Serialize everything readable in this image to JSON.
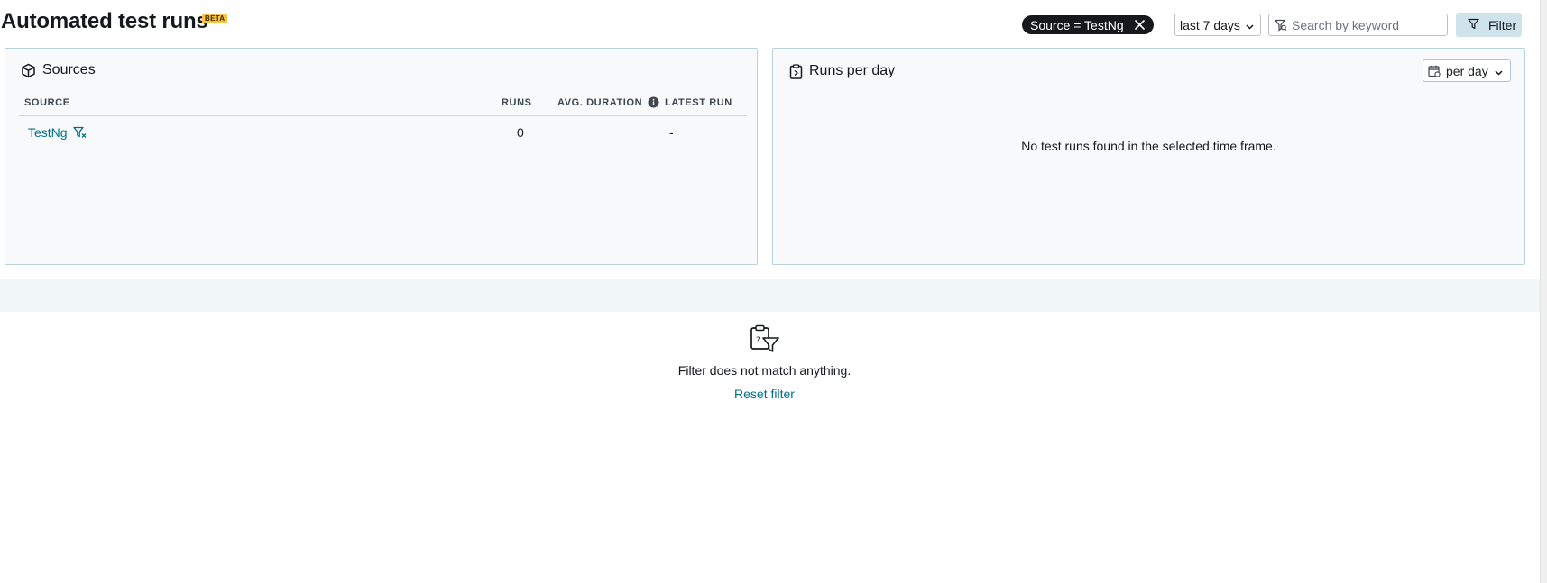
{
  "header": {
    "title": "Automated test runs",
    "badge": "BETA",
    "active_filter_chip": "Source = TestNg",
    "timeframe": "last 7 days",
    "search": {
      "placeholder": "Search by keyword",
      "value": ""
    },
    "filter_button": "Filter"
  },
  "sources_panel": {
    "title": "Sources",
    "columns": [
      "SOURCE",
      "RUNS",
      "AVG. DURATION",
      "LATEST RUN"
    ],
    "rows": [
      {
        "source": "TestNg",
        "runs": "0",
        "avg_duration": "",
        "latest_run": "-"
      }
    ]
  },
  "runs_panel": {
    "title": "Runs per day",
    "period": "per day",
    "empty_message": "No test runs found in the selected time frame."
  },
  "empty_state": {
    "message": "Filter does not match anything.",
    "reset_link": "Reset filter"
  },
  "colors": {
    "accent_link": "#00708a",
    "chip_bg": "#15181d",
    "beta_badge": "#f6c343",
    "filter_button_bg": "#cfe4ea",
    "panel_border": "#b8d3dc"
  },
  "icons": [
    "close-icon",
    "chevron-down-icon",
    "filter-search-icon",
    "filter-icon",
    "cube-icon",
    "info-icon",
    "filter-remove-icon",
    "clipboard-icon",
    "calendar-icon",
    "clipboard-filter-icon"
  ]
}
